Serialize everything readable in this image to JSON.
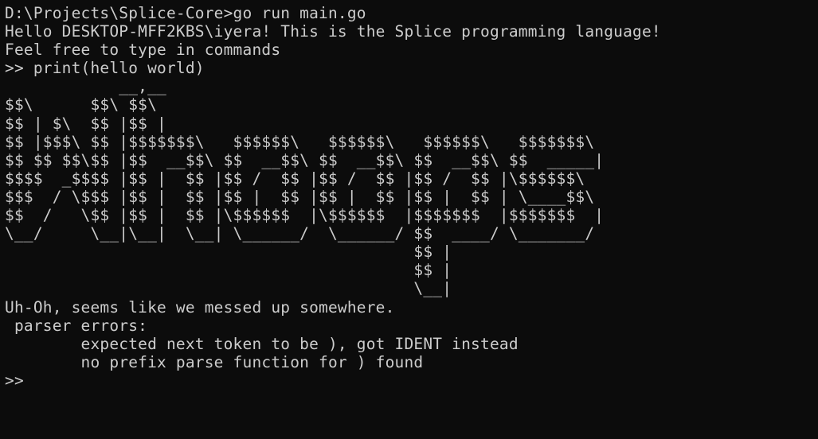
{
  "terminal": {
    "colors": {
      "background": "#0c0c0c",
      "foreground": "#cccccc"
    },
    "lines": [
      "D:\\Projects\\Splice-Core>go run main.go",
      "Hello DESKTOP-MFF2KBS\\iyera! This is the Splice programming language!",
      "Feel free to type in commands",
      ">> print(hello world)",
      "            __,__",
      "$$\\      $$\\ $$\\",
      "$$ | $\\  $$ |$$ |",
      "$$ |$$$\\ $$ |$$$$$$$\\   $$$$$$\\   $$$$$$\\   $$$$$$\\   $$$$$$$\\",
      "$$ $$ $$\\$$ |$$  __$$\\ $$  __$$\\ $$  __$$\\ $$  __$$\\ $$  _____|",
      "$$$$  _$$$$ |$$ |  $$ |$$ /  $$ |$$ /  $$ |$$ /  $$ |\\$$$$$$\\",
      "$$$  / \\$$$ |$$ |  $$ |$$ |  $$ |$$ |  $$ |$$ |  $$ | \\____$$\\",
      "$$  /   \\$$ |$$ |  $$ |\\$$$$$$  |\\$$$$$$  |$$$$$$$  |$$$$$$$  |",
      "\\__/     \\__|\\__|  \\__| \\______/  \\______/ $$  ____/ \\_______/",
      "                                           $$ |",
      "                                           $$ |",
      "                                           \\__|",
      "Uh-Oh, seems like we messed up somewhere.",
      " parser errors:",
      "        expected next token to be ), got IDENT instead",
      "        no prefix parse function for ) found"
    ],
    "prompt": ">>"
  }
}
